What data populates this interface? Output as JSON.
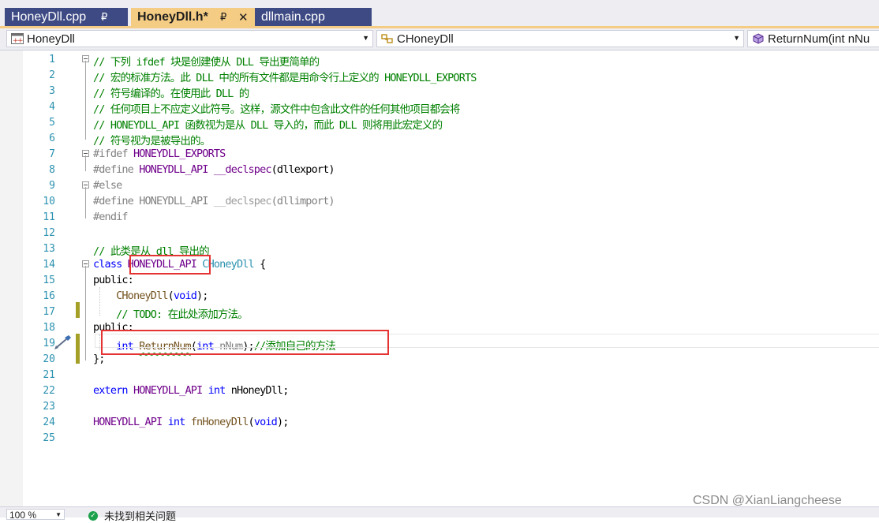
{
  "tabs": [
    {
      "label": "HoneyDll.cpp",
      "pin": "₽"
    },
    {
      "label": "HoneyDll.h*",
      "pin": "₽",
      "close": "✕"
    },
    {
      "label": "dllmain.cpp"
    }
  ],
  "nav": {
    "project": "HoneyDll",
    "scope": "CHoneyDll",
    "member": "ReturnNum(int nNu"
  },
  "status": {
    "zoom": "100 %",
    "issues": "未找到相关问题"
  },
  "watermark": "CSDN @XianLiangcheese",
  "lines": [
    {
      "n": "1",
      "t": [
        [
          "// 下列 ifdef 块是创建使从 DLL 导出更简单的",
          "c-green"
        ]
      ]
    },
    {
      "n": "2",
      "t": [
        [
          "// 宏的标准方法。此 DLL 中的所有文件都是用命令行上定义的 HONEYDLL_EXPORTS",
          "c-green"
        ]
      ]
    },
    {
      "n": "3",
      "t": [
        [
          "// 符号编译的。在使用此 DLL 的",
          "c-green"
        ]
      ]
    },
    {
      "n": "4",
      "t": [
        [
          "// 任何项目上不应定义此符号。这样，源文件中包含此文件的任何其他项目都会将",
          "c-green"
        ]
      ]
    },
    {
      "n": "5",
      "t": [
        [
          "// HONEYDLL_API 函数视为是从 DLL 导入的，而此 DLL 则将用此宏定义的",
          "c-green"
        ]
      ]
    },
    {
      "n": "6",
      "t": [
        [
          "// 符号视为是被导出的。",
          "c-green"
        ]
      ]
    },
    {
      "n": "7",
      "t": [
        [
          "#ifdef ",
          "c-gray"
        ],
        [
          "HONEYDLL_EXPORTS",
          "c-macro"
        ]
      ]
    },
    {
      "n": "8",
      "t": [
        [
          "#define ",
          "c-gray"
        ],
        [
          "HONEYDLL_API ",
          "c-macro"
        ],
        [
          "__declspec",
          "c-macro"
        ],
        [
          "(dllexport)",
          ""
        ]
      ]
    },
    {
      "n": "9",
      "t": [
        [
          "#else",
          "c-gray"
        ]
      ]
    },
    {
      "n": "10",
      "t": [
        [
          "#define HONEYDLL_API ",
          "c-gray"
        ],
        [
          "__declspec",
          "c-dim-macro"
        ],
        [
          "(dllimport)",
          "c-gray"
        ]
      ]
    },
    {
      "n": "11",
      "t": [
        [
          "#endif",
          "c-gray"
        ]
      ]
    },
    {
      "n": "12",
      "t": []
    },
    {
      "n": "13",
      "t": [
        [
          "// 此类是从 dll 导出的",
          "c-green"
        ]
      ]
    },
    {
      "n": "14",
      "t": [
        [
          "class ",
          "c-blue"
        ],
        [
          "HONEYDLL_API",
          "c-macro"
        ],
        [
          " ",
          ""
        ],
        [
          "CHoneyDll",
          "c-type"
        ],
        [
          " {",
          ""
        ]
      ]
    },
    {
      "n": "15",
      "t": [
        [
          "public",
          ""
        ],
        [
          ":",
          ""
        ]
      ]
    },
    {
      "n": "16",
      "t": [
        [
          "    ",
          ""
        ],
        [
          "CHoneyDll",
          "c-func"
        ],
        [
          "(",
          ""
        ],
        [
          "void",
          "c-blue"
        ],
        [
          ");",
          ""
        ]
      ]
    },
    {
      "n": "17",
      "t": [
        [
          "    // TODO: 在此处添加方法。",
          "c-green"
        ]
      ]
    },
    {
      "n": "18",
      "t": [
        [
          "public",
          ""
        ],
        [
          ":",
          ""
        ]
      ]
    },
    {
      "n": "19",
      "t": [
        [
          "    ",
          ""
        ],
        [
          "int ",
          "c-blue"
        ],
        [
          "ReturnNum",
          "c-func squig"
        ],
        [
          "(",
          ""
        ],
        [
          "int ",
          "c-blue"
        ],
        [
          "nNum",
          "c-param"
        ],
        [
          ");",
          ""
        ],
        [
          "//添加自己的方法",
          "c-green"
        ]
      ]
    },
    {
      "n": "20",
      "t": [
        [
          "};",
          ""
        ]
      ]
    },
    {
      "n": "21",
      "t": []
    },
    {
      "n": "22",
      "t": [
        [
          "extern ",
          "c-blue"
        ],
        [
          "HONEYDLL_API ",
          "c-macro"
        ],
        [
          "int ",
          "c-blue"
        ],
        [
          "nHoneyDll;",
          ""
        ]
      ]
    },
    {
      "n": "23",
      "t": []
    },
    {
      "n": "24",
      "t": [
        [
          "HONEYDLL_API ",
          "c-macro"
        ],
        [
          "int ",
          "c-blue"
        ],
        [
          "fnHoneyDll",
          "c-func"
        ],
        [
          "(",
          ""
        ],
        [
          "void",
          "c-blue"
        ],
        [
          ");",
          ""
        ]
      ]
    },
    {
      "n": "25",
      "t": []
    }
  ],
  "colors": {
    "tab_active": "#f5cc84",
    "tab_inactive": "#3e4a84",
    "comment": "#008000",
    "keyword": "#0000ff",
    "macro": "#6f008a",
    "annotation_box": "#e53333"
  }
}
